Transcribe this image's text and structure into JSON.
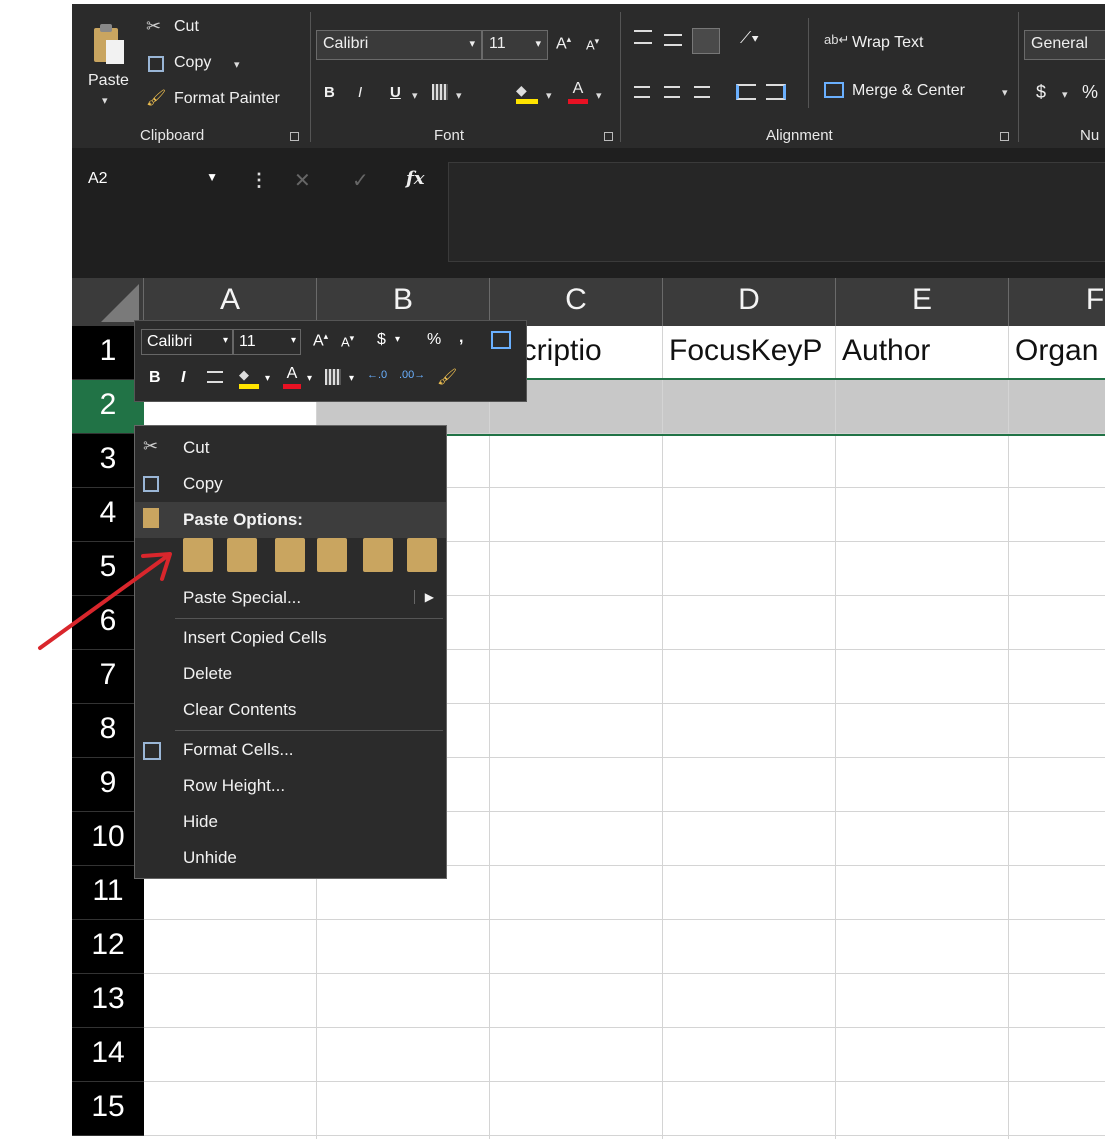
{
  "ribbon": {
    "clipboard": {
      "paste": "Paste",
      "cut": "Cut",
      "copy": "Copy",
      "format_painter": "Format Painter",
      "label": "Clipboard"
    },
    "font": {
      "name": "Calibri",
      "size": "11",
      "bold": "B",
      "italic": "I",
      "underline": "U",
      "label": "Font"
    },
    "alignment": {
      "wrap_text": "Wrap Text",
      "merge_center": "Merge & Center",
      "label": "Alignment"
    },
    "number": {
      "format": "General",
      "currency": "$",
      "percent": "%",
      "label": "Nu"
    }
  },
  "formula_bar": {
    "name_box": "A2",
    "fx": "fx"
  },
  "columns": [
    "A",
    "B",
    "C",
    "D",
    "E",
    "F"
  ],
  "rows": [
    "1",
    "2",
    "3",
    "4",
    "5",
    "6",
    "7",
    "8",
    "9",
    "10",
    "11",
    "12",
    "13",
    "14",
    "15"
  ],
  "row1_cells": {
    "c": "escriptio",
    "d": "FocusKeyP",
    "e": "Author",
    "f": "Organ"
  },
  "mini_toolbar": {
    "font": "Calibri",
    "size": "11",
    "bold": "B",
    "italic": "I",
    "currency": "$",
    "percent": "%",
    "comma": ","
  },
  "context_menu": {
    "cut": "Cut",
    "copy": "Copy",
    "paste_options": "Paste Options:",
    "paste_special": "Paste Special...",
    "insert_copied": "Insert Copied Cells",
    "delete": "Delete",
    "clear_contents": "Clear Contents",
    "format_cells": "Format Cells...",
    "row_height": "Row Height...",
    "hide": "Hide",
    "unhide": "Unhide"
  },
  "colors": {
    "ribbon_bg": "#2b2b2b",
    "selection_green": "#217346",
    "annotation_arrow": "#d9262c"
  }
}
